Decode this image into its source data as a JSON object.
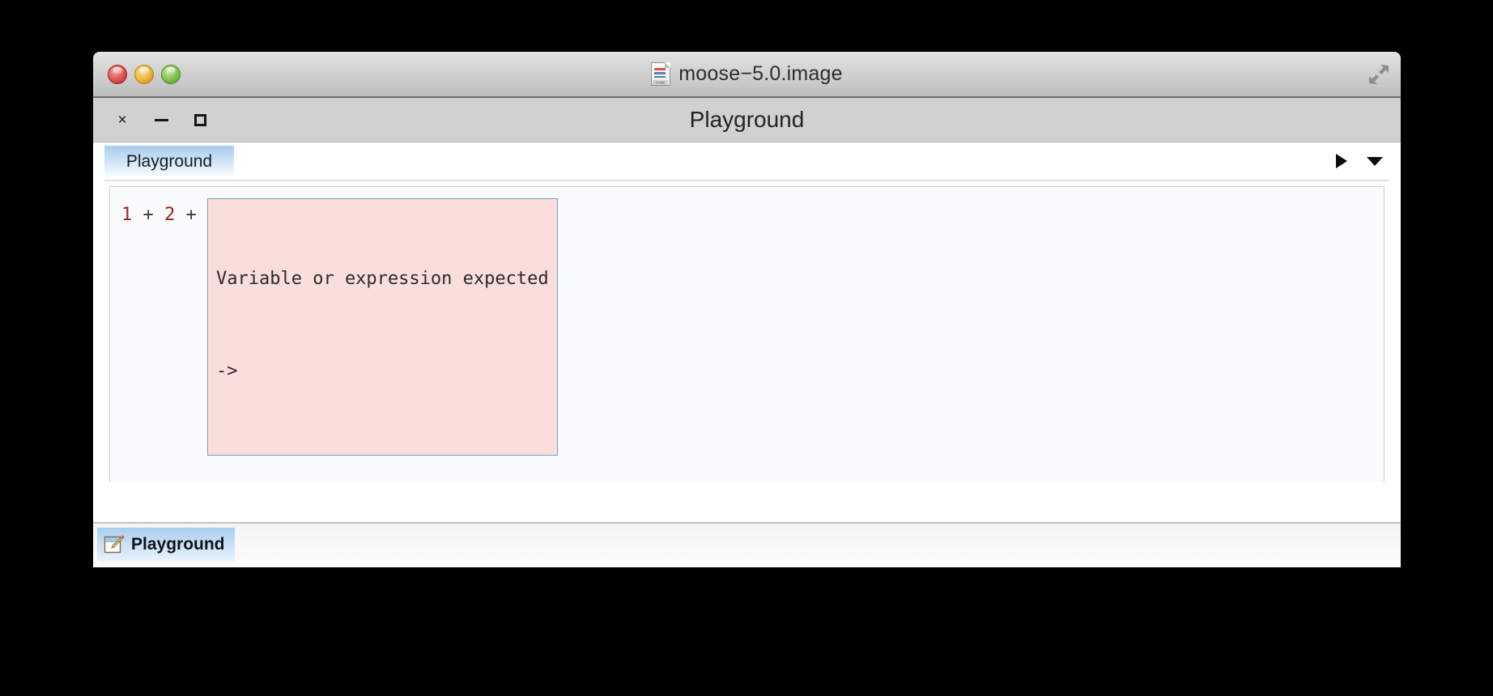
{
  "os_window": {
    "title": "moose−5.0.image",
    "doc_icon_label": "image",
    "traffic_lights": [
      {
        "name": "close",
        "color": "#e05050"
      },
      {
        "name": "minimize",
        "color": "#eeb13c"
      },
      {
        "name": "zoom",
        "color": "#7cc24a"
      }
    ],
    "fullscreen_icon": "resize-diagonal-icon"
  },
  "app_window": {
    "title": "Playground",
    "controls": {
      "close": "×",
      "minimize": "−",
      "maximize": "□"
    }
  },
  "tabs": [
    {
      "label": "Playground",
      "active": true
    }
  ],
  "toolbar": {
    "run_icon": "play-triangle-icon",
    "menu_icon": "chevron-down-icon"
  },
  "editor": {
    "code_tokens": [
      {
        "text": "1",
        "type": "number"
      },
      {
        "text": " + ",
        "type": "operator"
      },
      {
        "text": "2",
        "type": "number"
      },
      {
        "text": " + ",
        "type": "operator"
      }
    ],
    "code_plain": "1 + 2 + ",
    "error_box": {
      "line1": "Variable or expression expected",
      "line2": "->",
      "background": "#fadedb",
      "border": "#6d9fd0"
    }
  },
  "taskbar": {
    "items": [
      {
        "label": "Playground",
        "icon": "playground-pencil-icon"
      }
    ]
  },
  "colors": {
    "desktop": "#000000",
    "window_chrome": "#d4d4d4",
    "tab_active": "#a8cdf0",
    "code_number": "#a02020"
  }
}
